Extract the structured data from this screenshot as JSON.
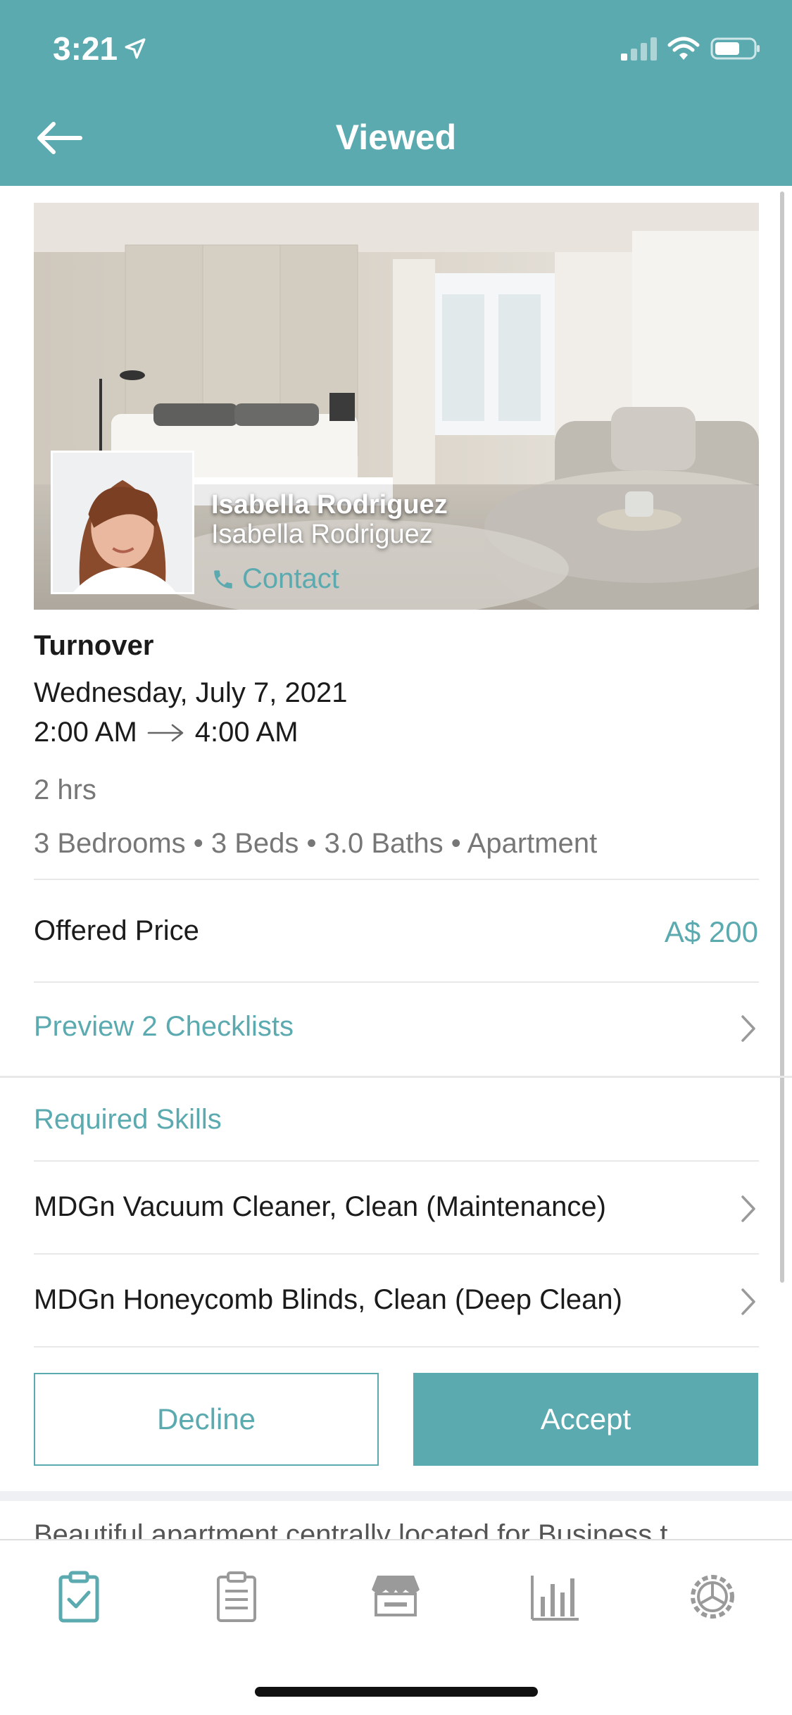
{
  "status_bar": {
    "time": "3:21"
  },
  "header": {
    "title": "Viewed"
  },
  "host": {
    "name": "Isabella Rodriguez",
    "subtitle": "Isabella Rodriguez",
    "contact_label": "Contact"
  },
  "job": {
    "type": "Turnover",
    "date": "Wednesday, July 7, 2021",
    "start_time": "2:00 AM",
    "end_time": "4:00 AM",
    "duration": "2 hrs",
    "specs": "3 Bedrooms • 3 Beds • 3.0 Baths • Apartment"
  },
  "price": {
    "label": "Offered Price",
    "value": "A$ 200"
  },
  "checklists": {
    "label": "Preview 2 Checklists"
  },
  "skills": {
    "title": "Required Skills",
    "items": [
      "MDGn Vacuum Cleaner, Clean (Maintenance)",
      "MDGn Honeycomb Blinds, Clean (Deep Clean)"
    ]
  },
  "actions": {
    "decline": "Decline",
    "accept": "Accept"
  },
  "description": "Beautiful apartment centrally located for Business t",
  "tabbar": {
    "icons": [
      "clipboard-check-icon",
      "clipboard-list-icon",
      "store-icon",
      "bar-chart-icon",
      "settings-gear-icon"
    ],
    "active_index": 0
  },
  "colors": {
    "accent": "#5aaab0",
    "text": "#1b1b1b",
    "muted": "#777777"
  }
}
